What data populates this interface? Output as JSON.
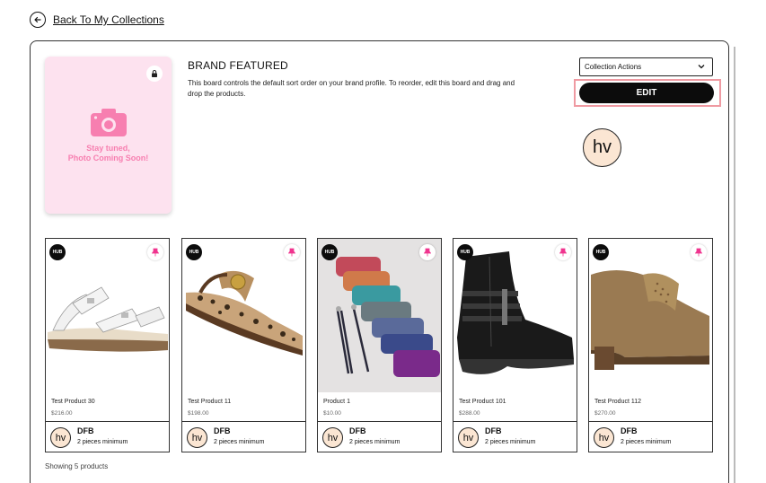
{
  "nav": {
    "back_label": "Back To My Collections"
  },
  "collection": {
    "title": "BRAND FEATURED",
    "description": "This board controls the default sort order on your brand profile. To reorder, edit this board and drag and drop the products.",
    "cover_text_line1": "Stay tuned,",
    "cover_text_line2": "Photo Coming Soon!",
    "actions_label": "Collection Actions",
    "edit_label": "EDIT",
    "brand_initials": "hv"
  },
  "products": [
    {
      "name": "Test Product 30",
      "price": "$216.00",
      "hub": "HUB",
      "vendor": "DFB",
      "minimum": "2 pieces minimum",
      "vendor_initials": "hv"
    },
    {
      "name": "Test Product 11",
      "price": "$198.00",
      "hub": "HUB",
      "vendor": "DFB",
      "minimum": "2 pieces minimum",
      "vendor_initials": "hv"
    },
    {
      "name": "Product 1",
      "price": "$10.00",
      "hub": "HUB",
      "vendor": "DFB",
      "minimum": "2 pieces minimum",
      "vendor_initials": "hv"
    },
    {
      "name": "Test Product 101",
      "price": "$288.00",
      "hub": "HUB",
      "vendor": "DFB",
      "minimum": "2 pieces minimum",
      "vendor_initials": "hv"
    },
    {
      "name": "Test Product 112",
      "price": "$270.00",
      "hub": "HUB",
      "vendor": "DFB",
      "minimum": "2 pieces minimum",
      "vendor_initials": "hv"
    }
  ],
  "footer": {
    "showing": "Showing 5 products"
  },
  "colors": {
    "accent_pink": "#f0348f",
    "cover_bg": "#fde2ef",
    "edit_bg": "#0c0c0c",
    "highlight": "#ef9aa2"
  }
}
